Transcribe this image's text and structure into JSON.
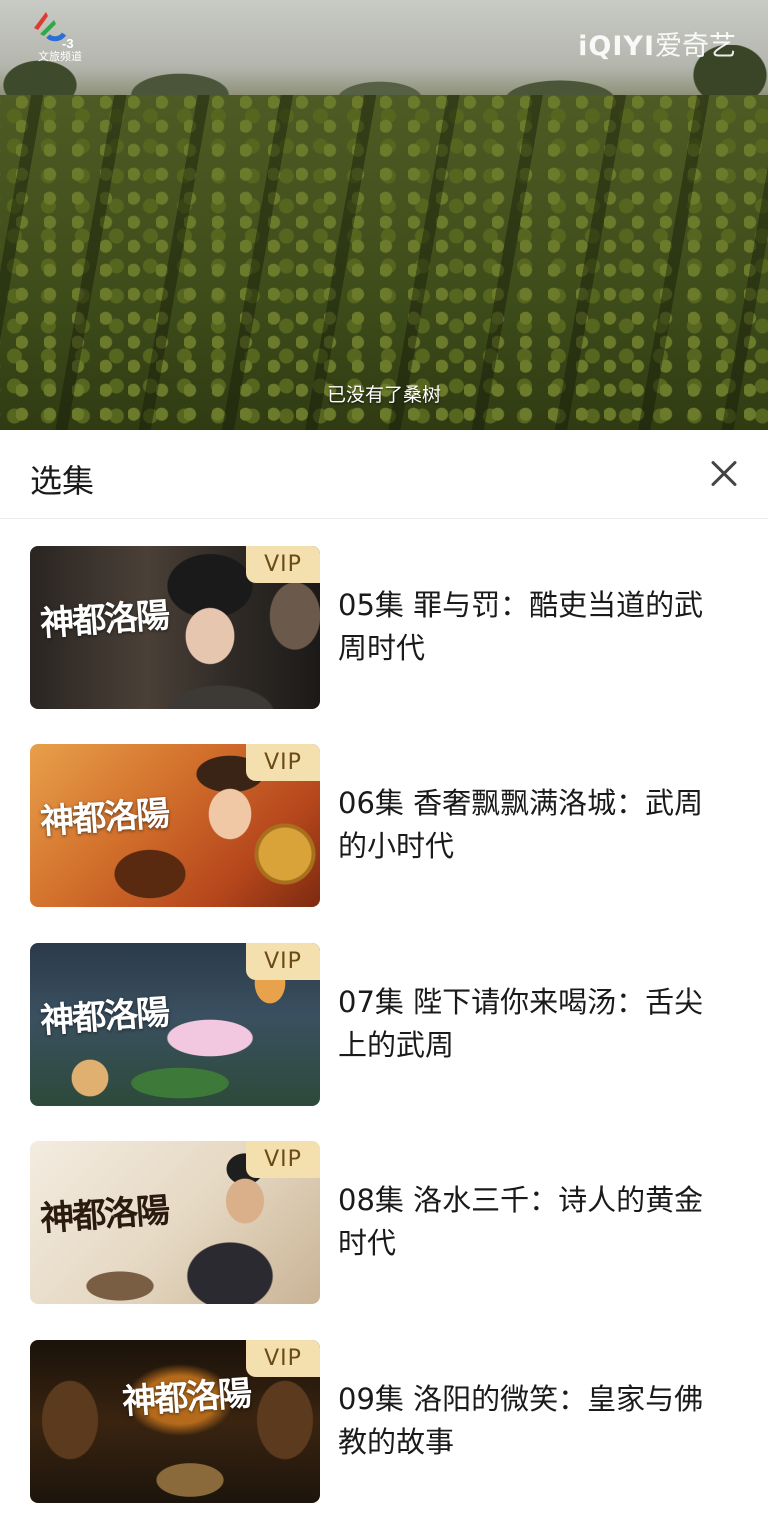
{
  "video": {
    "channel_logo_number": "-3",
    "channel_name": "文旅频道",
    "brand_latin": "iQIYI",
    "brand_cn": "爱奇艺",
    "subtitle": "已没有了桑树"
  },
  "panel": {
    "title": "选集",
    "close_icon": "close-icon",
    "episodes": [
      {
        "title": "05集 罪与罚：酷吏当道的武周时代",
        "badge": "VIP",
        "series_mark": "神都洛陽"
      },
      {
        "title": "06集 香奢飘飘满洛城：武周的小时代",
        "badge": "VIP",
        "series_mark": "神都洛陽"
      },
      {
        "title": "07集 陛下请你来喝汤：舌尖上的武周",
        "badge": "VIP",
        "series_mark": "神都洛陽"
      },
      {
        "title": "08集 洛水三千：诗人的黄金时代",
        "badge": "VIP",
        "series_mark": "神都洛陽"
      },
      {
        "title": "09集 洛阳的微笑：皇家与佛教的故事",
        "badge": "VIP",
        "series_mark": "神都洛陽"
      }
    ]
  },
  "colors": {
    "vip_badge_bg": "#f4dfae",
    "vip_badge_text": "#6b4a16",
    "title_text": "#1a1a1a"
  }
}
